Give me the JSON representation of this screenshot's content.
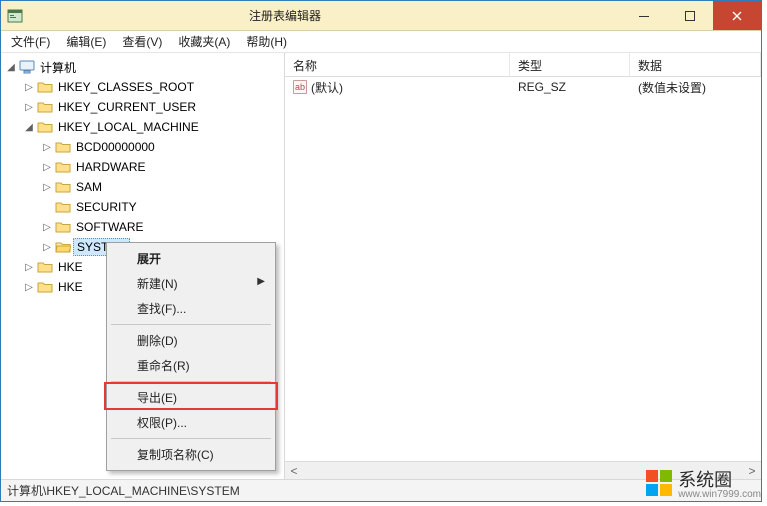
{
  "window": {
    "title": "注册表编辑器"
  },
  "menubar": {
    "file": "文件(F)",
    "edit": "编辑(E)",
    "view": "查看(V)",
    "favorites": "收藏夹(A)",
    "help": "帮助(H)"
  },
  "tree": {
    "root": "计算机",
    "hkcr": "HKEY_CLASSES_ROOT",
    "hkcu": "HKEY_CURRENT_USER",
    "hklm": "HKEY_LOCAL_MACHINE",
    "hklm_children": {
      "bcd": "BCD00000000",
      "hardware": "HARDWARE",
      "sam": "SAM",
      "security": "SECURITY",
      "software": "SOFTWARE",
      "system": "SYSTEM"
    },
    "hku_partial": "HKE",
    "hkcc_partial": "HKE"
  },
  "list": {
    "columns": {
      "name": "名称",
      "type": "类型",
      "data": "数据"
    },
    "rows": [
      {
        "icon": "ab",
        "name": "(默认)",
        "type": "REG_SZ",
        "data": "(数值未设置)"
      }
    ]
  },
  "context_menu": {
    "expand": "展开",
    "new": "新建(N)",
    "find": "查找(F)...",
    "delete": "删除(D)",
    "rename": "重命名(R)",
    "export": "导出(E)",
    "permissions": "权限(P)...",
    "copy_key": "复制项名称(C)"
  },
  "statusbar": {
    "path": "计算机\\HKEY_LOCAL_MACHINE\\SYSTEM"
  },
  "watermark": {
    "brand": "系统圈",
    "url": "www.win7999.com"
  }
}
